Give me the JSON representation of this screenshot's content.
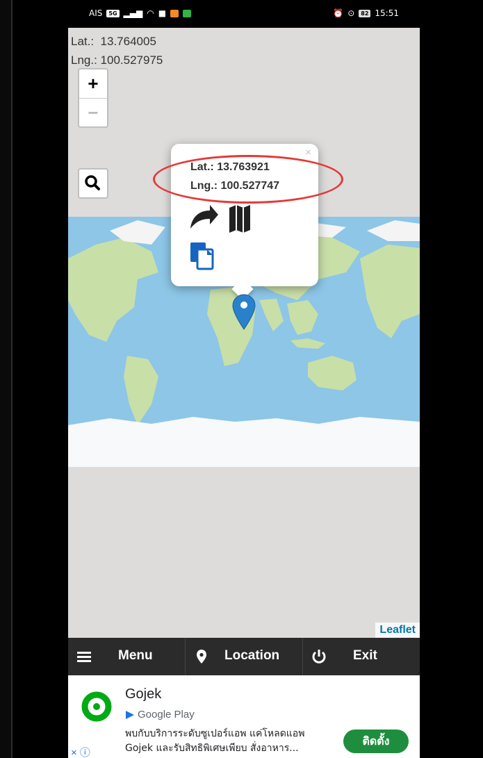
{
  "status_bar": {
    "carrier": "AIS",
    "carrier_badge": "5G",
    "battery": "82",
    "time": "15:51"
  },
  "map": {
    "current_lat_label": "Lat.:",
    "current_lat_value": "13.764005",
    "current_lng_label": "Lng.:",
    "current_lng_value": "100.527975",
    "zoom_in": "+",
    "zoom_out": "−",
    "attribution": "Leaflet",
    "popup": {
      "close": "×",
      "lat_line": "Lat.: 13.763921",
      "lng_line": "Lng.: 100.527747"
    }
  },
  "bottom_bar": {
    "menu": "Menu",
    "location": "Location",
    "exit": "Exit"
  },
  "ad": {
    "title": "Gojek",
    "store": "Google Play",
    "desc_line1": "พบกับบริการระดับซูเปอร์แอพ แค่โหลดแอพ",
    "desc_line2": "Gojek และรับสิทธิพิเศษเพียบ สั่งอาหาร...",
    "install": "ติดตั้ง",
    "close": "× ⓘ"
  },
  "colors": {
    "ocean": "#8dc6e6",
    "land": "#c9dfa8",
    "marker": "#2a81cb",
    "bottom_bar": "#2b2b2b",
    "install_button": "#1e8e3e",
    "highlight": "#e53935"
  }
}
